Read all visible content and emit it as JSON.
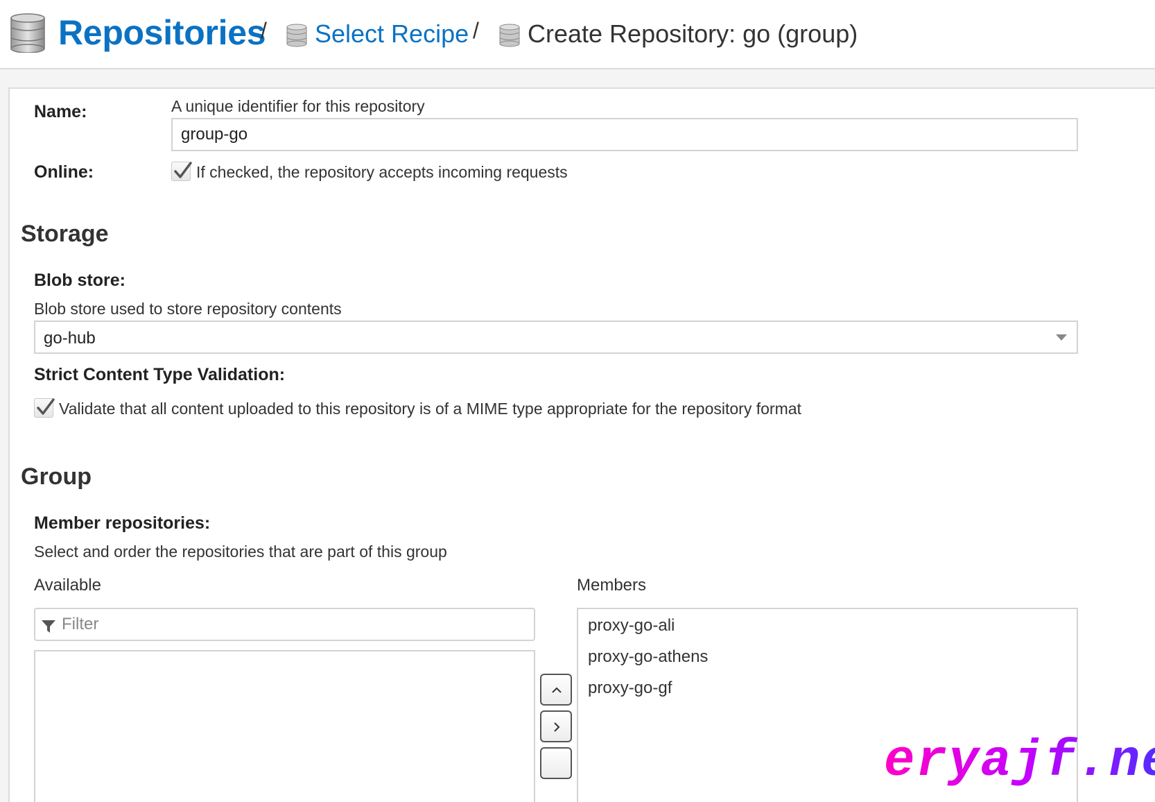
{
  "breadcrumb": {
    "root": "Repositories",
    "separator": "/",
    "step1": "Select Recipe",
    "current": "Create Repository: go (group)"
  },
  "form": {
    "name_label": "Name:",
    "name_help": "A unique identifier for this repository",
    "name_value": "group-go",
    "online_label": "Online:",
    "online_checked": true,
    "online_help": "If checked, the repository accepts incoming requests"
  },
  "storage": {
    "title": "Storage",
    "blob_label": "Blob store:",
    "blob_help": "Blob store used to store repository contents",
    "blob_value": "go-hub",
    "strict_label": "Strict Content Type Validation:",
    "strict_checked": true,
    "strict_help": "Validate that all content uploaded to this repository is of a MIME type appropriate for the repository format"
  },
  "group": {
    "title": "Group",
    "members_label": "Member repositories:",
    "members_help": "Select and order the repositories that are part of this group",
    "available_label": "Available",
    "filter_placeholder": "Filter",
    "members_list_label": "Members",
    "members": [
      "proxy-go-ali",
      "proxy-go-athens",
      "proxy-go-gf"
    ]
  },
  "watermark": "eryajf.net",
  "colors": {
    "link": "#0b72c3",
    "text": "#333333",
    "border": "#d3d3d3"
  }
}
